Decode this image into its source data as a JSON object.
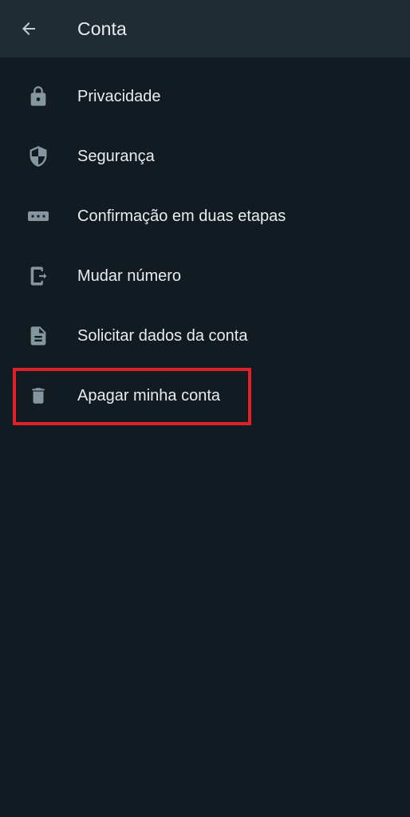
{
  "header": {
    "title": "Conta",
    "back_icon": "arrow-left-icon"
  },
  "colors": {
    "background": "#121b22",
    "header_background": "#1f2c34",
    "text": "#e9edef",
    "icon": "#8696a0",
    "highlight": "#e02125"
  },
  "menu": {
    "items": [
      {
        "label": "Privacidade",
        "icon": "lock-icon"
      },
      {
        "label": "Segurança",
        "icon": "shield-icon"
      },
      {
        "label": "Confirmação em duas etapas",
        "icon": "password-dots-icon"
      },
      {
        "label": "Mudar número",
        "icon": "phone-transfer-icon"
      },
      {
        "label": "Solicitar dados da conta",
        "icon": "document-icon"
      },
      {
        "label": "Apagar minha conta",
        "icon": "trash-icon"
      }
    ]
  }
}
